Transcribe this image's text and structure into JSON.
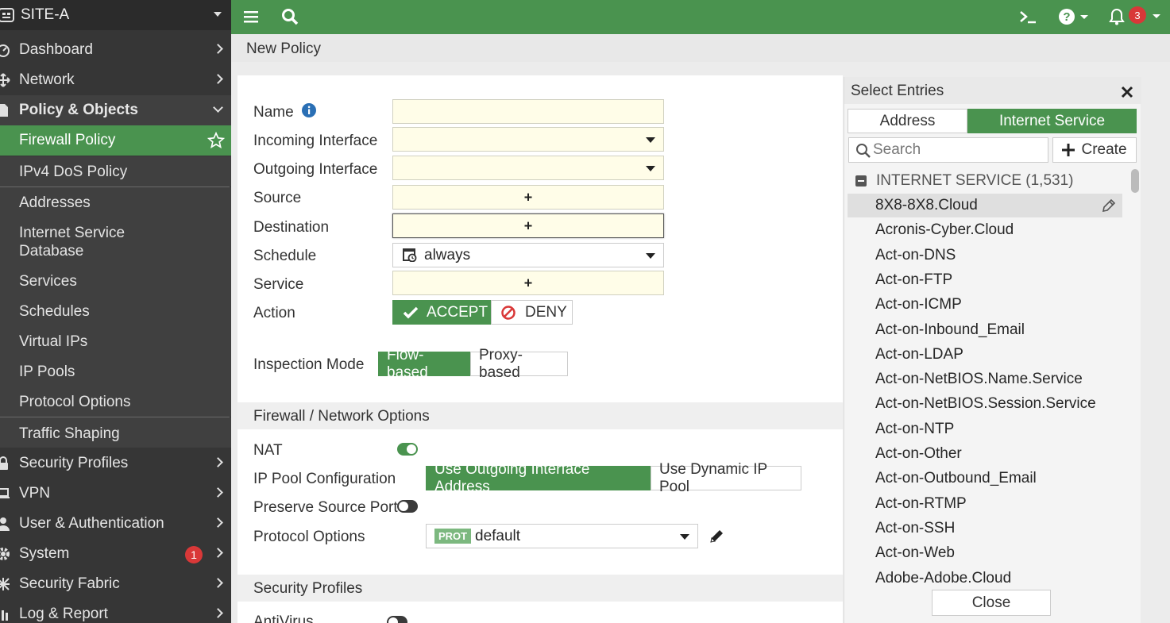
{
  "site": {
    "name": "SITE-A"
  },
  "nav": {
    "dashboard": "Dashboard",
    "network": "Network",
    "policy_objects": "Policy & Objects",
    "firewall_policy": "Firewall Policy",
    "ipv4_dos": "IPv4 DoS Policy",
    "addresses": "Addresses",
    "isdb": "Internet Service Database",
    "services": "Services",
    "schedules": "Schedules",
    "virtual_ips": "Virtual IPs",
    "ip_pools": "IP Pools",
    "protocol_options": "Protocol Options",
    "traffic_shaping": "Traffic Shaping",
    "security_profiles": "Security Profiles",
    "vpn": "VPN",
    "user_auth": "User & Authentication",
    "system": "System",
    "system_badge": "1",
    "security_fabric": "Security Fabric",
    "log_report": "Log & Report"
  },
  "topbar": {
    "alerts_count": "3"
  },
  "page": {
    "title": "New Policy"
  },
  "form": {
    "name_label": "Name",
    "incoming_label": "Incoming Interface",
    "outgoing_label": "Outgoing Interface",
    "source_label": "Source",
    "destination_label": "Destination",
    "schedule_label": "Schedule",
    "schedule_value": "always",
    "service_label": "Service",
    "action_label": "Action",
    "accept": "ACCEPT",
    "deny": "DENY",
    "inspection_label": "Inspection Mode",
    "flow_based": "Flow-based",
    "proxy_based": "Proxy-based",
    "fw_section": "Firewall / Network Options",
    "nat_label": "NAT",
    "nat_on": true,
    "ippool_label": "IP Pool Configuration",
    "use_outgoing": "Use Outgoing Interface Address",
    "use_dynamic": "Use Dynamic IP Pool",
    "preserve_label": "Preserve Source Port",
    "preserve_on": false,
    "protocol_label": "Protocol Options",
    "prot_tag": "PROT",
    "protocol_value": "default",
    "sec_section": "Security Profiles",
    "antivirus_label": "AntiVirus",
    "plus": "+"
  },
  "entries": {
    "title": "Select Entries",
    "tab_address": "Address",
    "tab_internet_service": "Internet Service",
    "search_placeholder": "Search",
    "create": "Create",
    "group_label": "INTERNET SERVICE (1,531)",
    "items": [
      "8X8-8X8.Cloud",
      "Acronis-Cyber.Cloud",
      "Act-on-DNS",
      "Act-on-FTP",
      "Act-on-ICMP",
      "Act-on-Inbound_Email",
      "Act-on-LDAP",
      "Act-on-NetBIOS.Name.Service",
      "Act-on-NetBIOS.Session.Service",
      "Act-on-NTP",
      "Act-on-Other",
      "Act-on-Outbound_Email",
      "Act-on-RTMP",
      "Act-on-SSH",
      "Act-on-Web",
      "Adobe-Adobe.Cloud"
    ],
    "close": "Close"
  },
  "colors": {
    "accent": "#4a934f",
    "sidebar": "#363636",
    "field_bg": "#fffde8",
    "badge": "#d93838"
  }
}
